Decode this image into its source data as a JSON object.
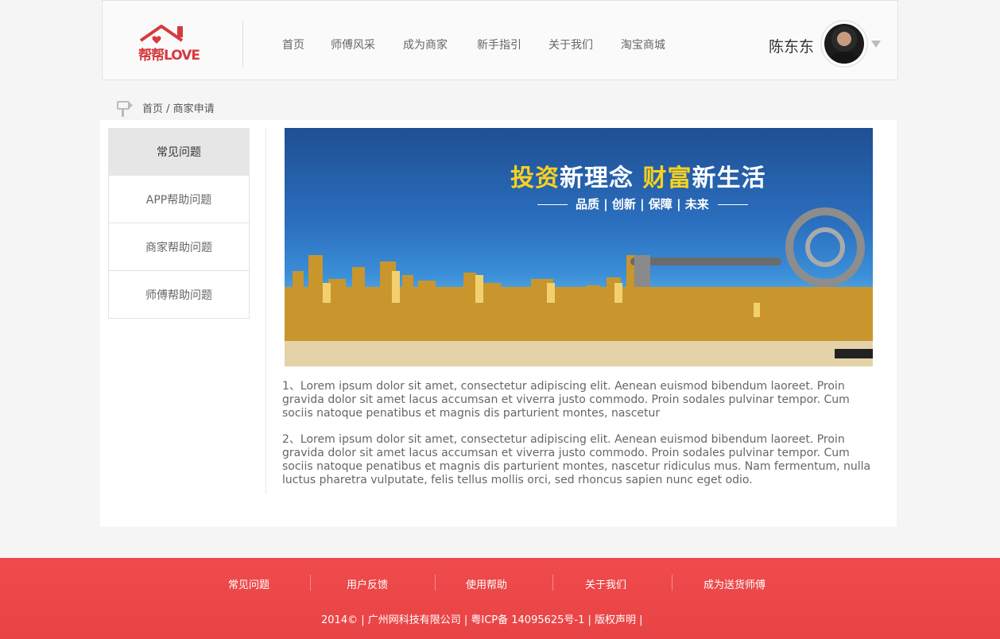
{
  "header": {
    "logo_text": "帮帮LOVE",
    "nav": [
      "首页",
      "师傅风采",
      "成为商家",
      "新手指引",
      "关于我们",
      "淘宝商城"
    ],
    "user_name": "陈东东"
  },
  "breadcrumb": "首页 / 商家申请",
  "sidebar": {
    "items": [
      "常见问题",
      "APP帮助问题",
      "商家帮助问题",
      "师傅帮助问题"
    ]
  },
  "banner": {
    "title_yellow_1": "投资",
    "title_white_1": "新理念",
    "title_yellow_2": "财富",
    "title_white_2": "新生活",
    "subtitle": "品质 | 创新 | 保障 | 未来"
  },
  "content": {
    "paragraphs": [
      "1、Lorem ipsum dolor sit amet, consectetur adipiscing elit. Aenean euismod bibendum laoreet. Proin gravida dolor sit amet lacus accumsan et viverra justo commodo. Proin sodales pulvinar tempor. Cum sociis natoque penatibus et magnis dis parturient montes, nascetur",
      "2、Lorem ipsum dolor sit amet, consectetur adipiscing elit. Aenean euismod bibendum laoreet. Proin gravida dolor sit amet lacus accumsan et viverra justo commodo. Proin sodales pulvinar tempor. Cum sociis natoque penatibus et magnis dis parturient montes, nascetur ridiculus mus. Nam fermentum, nulla luctus pharetra vulputate, felis tellus mollis orci, sed rhoncus sapien nunc eget odio."
    ]
  },
  "footer": {
    "links": [
      "常见问题",
      "用户反馈",
      "使用帮助",
      "关于我们",
      "成为送货师傅"
    ],
    "copyright": "2014©  |  广州网科技有限公司  |  粤ICP备 14095625号-1  |  版权声明  |"
  },
  "colors": {
    "brand_red": "#e84446",
    "logo_red": "#d63a3e",
    "banner_yellow": "#f7d11e"
  }
}
